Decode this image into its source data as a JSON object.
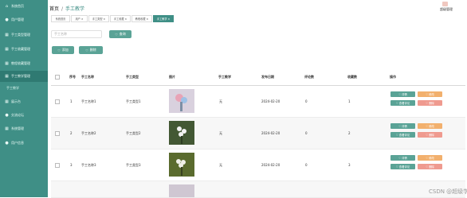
{
  "sidebar": {
    "items": [
      {
        "icon": "home-icon",
        "label": "系统首页"
      },
      {
        "icon": "user-icon",
        "label": "用户管理"
      },
      {
        "icon": "grid-icon",
        "label": "手工类型管理"
      },
      {
        "icon": "grid-icon",
        "label": "手工收藏管理"
      },
      {
        "icon": "grid-icon",
        "label": "教程收藏管理"
      },
      {
        "icon": "grid-icon",
        "label": "手工教学管理"
      },
      {
        "icon": "grid-icon",
        "label": "展示台"
      },
      {
        "icon": "user-icon",
        "label": "交流论坛"
      },
      {
        "icon": "grid-icon",
        "label": "系统管理"
      },
      {
        "icon": "user-icon",
        "label": "用户信息"
      }
    ],
    "submenu": {
      "label": "手工教学"
    }
  },
  "header": {
    "breadcrumb": {
      "home": "首页",
      "separator": "/",
      "current": "手工教学"
    },
    "user_name": "超级管理"
  },
  "tabs": [
    {
      "label": "系统首页"
    },
    {
      "label": "用户 ×"
    },
    {
      "label": "手工类型 ×"
    },
    {
      "label": "手工收藏 ×"
    },
    {
      "label": "教程收藏 ×"
    },
    {
      "label": "手工教学 ×"
    }
  ],
  "search": {
    "placeholder": "手工名称",
    "button_label": "查询"
  },
  "toolbar": {
    "add_label": "添加",
    "delete_label": "删除"
  },
  "table": {
    "headers": [
      "序号",
      "手工名称",
      "手工类型",
      "图片",
      "手工教学",
      "发布日期",
      "评论数",
      "收藏数",
      "操作"
    ],
    "rows": [
      {
        "index": "1",
        "name": "手工名称1",
        "type": "手工类型1",
        "teaching": "无",
        "date": "2024-02-20",
        "comments": "0",
        "favorites": "1"
      },
      {
        "index": "2",
        "name": "手工名称2",
        "type": "手工类型2",
        "teaching": "无",
        "date": "2024-02-20",
        "comments": "0",
        "favorites": "2"
      },
      {
        "index": "3",
        "name": "手工名称3",
        "type": "手工类型3",
        "teaching": "无",
        "date": "2024-02-20",
        "comments": "0",
        "favorites": "3"
      }
    ],
    "actions": {
      "detail": "详情",
      "edit": "修改",
      "review": "查看评论",
      "delete": "删除"
    }
  },
  "watermark": "CSDN @超级学姐毕设"
}
